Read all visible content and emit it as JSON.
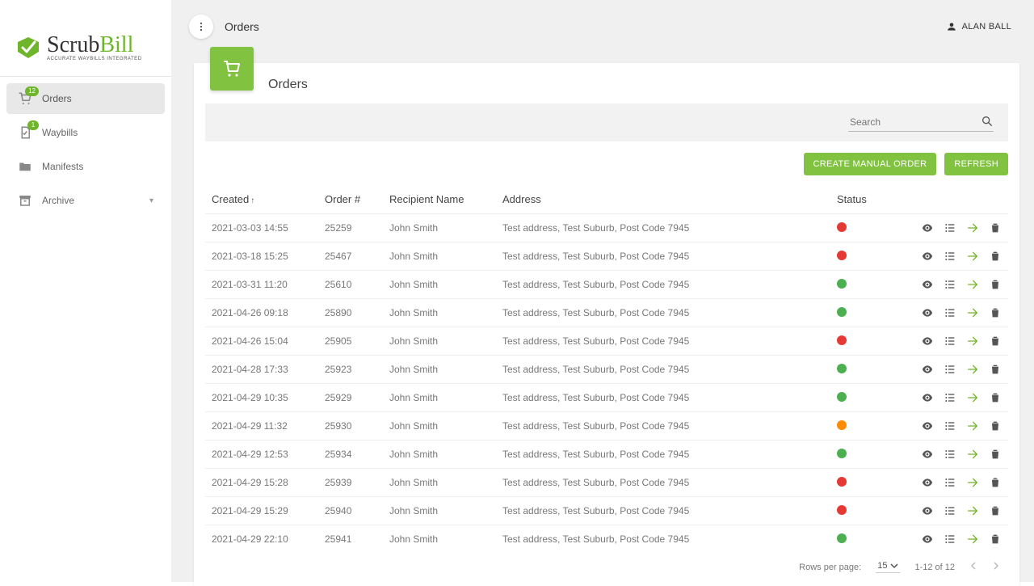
{
  "brand": {
    "name_a": "Scrub",
    "name_b": "Bill",
    "tagline": "ACCURATE WAYBILLS INTEGRATED"
  },
  "user": {
    "name": "ALAN BALL"
  },
  "header": {
    "title": "Orders"
  },
  "sidebar": {
    "items": [
      {
        "label": "Orders",
        "badge": "12",
        "active": true
      },
      {
        "label": "Waybills",
        "badge": "1",
        "active": false
      },
      {
        "label": "Manifests",
        "badge": null,
        "active": false
      },
      {
        "label": "Archive",
        "badge": null,
        "active": false,
        "expandable": true
      }
    ]
  },
  "page": {
    "title": "Orders",
    "search_placeholder": "Search",
    "create_label": "CREATE MANUAL ORDER",
    "refresh_label": "REFRESH"
  },
  "table": {
    "columns": {
      "created": "Created",
      "order": "Order #",
      "recipient": "Recipient Name",
      "address": "Address",
      "status": "Status"
    },
    "sort": {
      "column": "created",
      "dir": "asc"
    },
    "rows": [
      {
        "created": "2021-03-03 14:55",
        "order": "25259",
        "recipient": "John Smith",
        "address": "Test address, Test Suburb, Post Code 7945",
        "status": "red"
      },
      {
        "created": "2021-03-18 15:25",
        "order": "25467",
        "recipient": "John Smith",
        "address": "Test address, Test Suburb, Post Code 7945",
        "status": "red"
      },
      {
        "created": "2021-03-31 11:20",
        "order": "25610",
        "recipient": "John Smith",
        "address": "Test address, Test Suburb, Post Code 7945",
        "status": "green"
      },
      {
        "created": "2021-04-26 09:18",
        "order": "25890",
        "recipient": "John Smith",
        "address": "Test address, Test Suburb, Post Code 7945",
        "status": "green"
      },
      {
        "created": "2021-04-26 15:04",
        "order": "25905",
        "recipient": "John Smith",
        "address": "Test address, Test Suburb, Post Code 7945",
        "status": "red"
      },
      {
        "created": "2021-04-28 17:33",
        "order": "25923",
        "recipient": "John Smith",
        "address": "Test address, Test Suburb, Post Code 7945",
        "status": "green"
      },
      {
        "created": "2021-04-29 10:35",
        "order": "25929",
        "recipient": "John Smith",
        "address": "Test address, Test Suburb, Post Code 7945",
        "status": "green"
      },
      {
        "created": "2021-04-29 11:32",
        "order": "25930",
        "recipient": "John Smith",
        "address": "Test address, Test Suburb, Post Code 7945",
        "status": "orange"
      },
      {
        "created": "2021-04-29 12:53",
        "order": "25934",
        "recipient": "John Smith",
        "address": "Test address, Test Suburb, Post Code 7945",
        "status": "green"
      },
      {
        "created": "2021-04-29 15:28",
        "order": "25939",
        "recipient": "John Smith",
        "address": "Test address, Test Suburb, Post Code 7945",
        "status": "red"
      },
      {
        "created": "2021-04-29 15:29",
        "order": "25940",
        "recipient": "John Smith",
        "address": "Test address, Test Suburb, Post Code 7945",
        "status": "red"
      },
      {
        "created": "2021-04-29 22:10",
        "order": "25941",
        "recipient": "John Smith",
        "address": "Test address, Test Suburb, Post Code 7945",
        "status": "green"
      }
    ]
  },
  "pagination": {
    "rows_label": "Rows per page:",
    "rows_value": "15",
    "range_label": "1-12 of 12"
  }
}
